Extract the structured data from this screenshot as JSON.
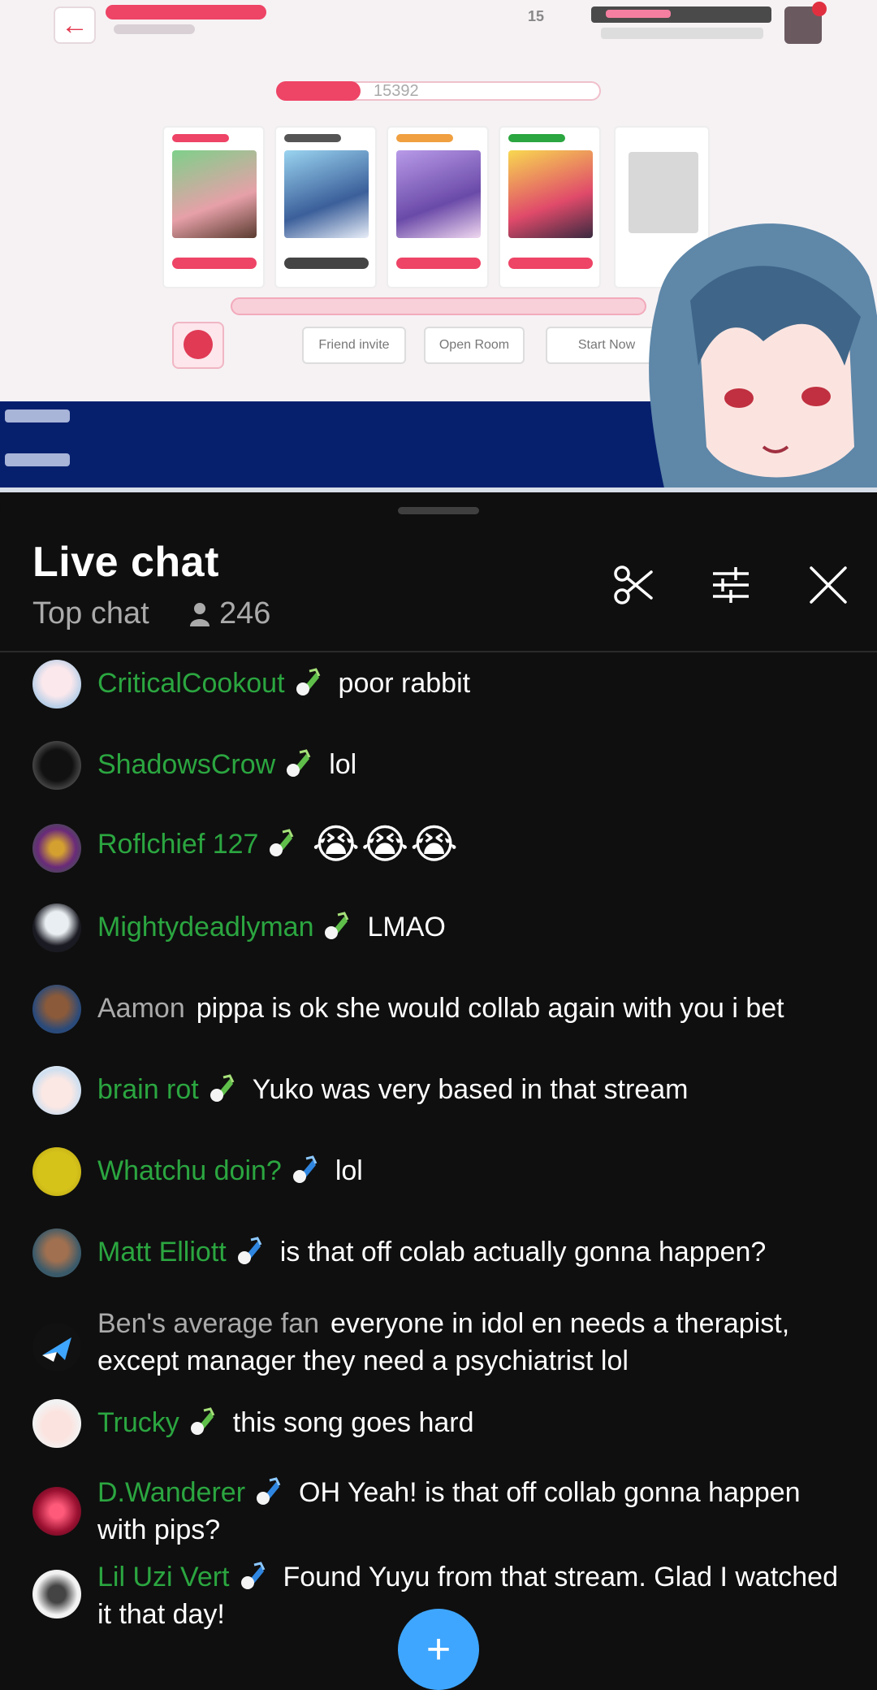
{
  "video": {
    "room_number": "15392",
    "buttons": [
      "Friend invite",
      "Open Room",
      "Start Now"
    ]
  },
  "header": {
    "title": "Live chat",
    "mode": "Top chat",
    "viewer_count": "246",
    "icons": [
      "scissors-icon",
      "filter-icon",
      "close-icon"
    ]
  },
  "colors": {
    "member_name": "#2ba640",
    "plain_name": "#aaaaaa",
    "accent_blue": "#3ea6ff"
  },
  "messages": [
    {
      "author": "CriticalCookout",
      "badge": "green",
      "text": "poor rabbit"
    },
    {
      "author": "ShadowsCrow",
      "badge": "green",
      "text": "lol"
    },
    {
      "author": "Roflchief 127",
      "badge": "green",
      "text": "😭😭😭"
    },
    {
      "author": "Mightydeadlyman",
      "badge": "green",
      "text": "LMAO"
    },
    {
      "author": "Aamon",
      "badge": "none",
      "text": "pippa is ok she would collab again with you i bet"
    },
    {
      "author": "brain rot",
      "badge": "green",
      "text": "Yuko was very based in that stream"
    },
    {
      "author": "Whatchu doin?",
      "badge": "blue",
      "text": "lol"
    },
    {
      "author": "Matt Elliott",
      "badge": "blue",
      "text": "is that off colab actually gonna happen?"
    },
    {
      "author": "Ben's average fan",
      "badge": "none",
      "text": "everyone in idol en needs a therapist, except manager they need a psychiatrist lol"
    },
    {
      "author": "Trucky",
      "badge": "green",
      "text": "this song goes hard"
    },
    {
      "author": "D.Wanderer",
      "badge": "blue",
      "text": "OH Yeah! is that off collab gonna happen with pips?"
    },
    {
      "author": "Lil Uzi Vert",
      "badge": "blue",
      "text": "Found Yuyu from that stream. Glad I watched it that day!"
    }
  ],
  "fab": {
    "label": "+"
  }
}
